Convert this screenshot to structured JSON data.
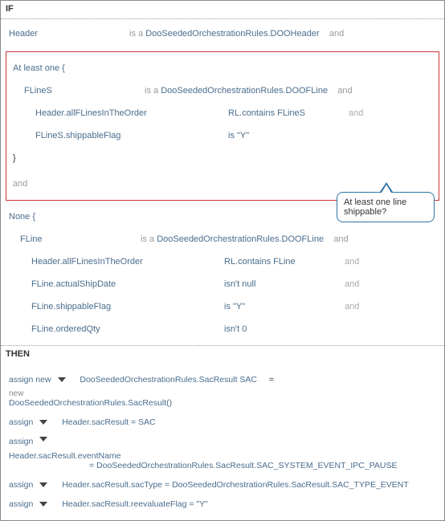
{
  "ifLabel": "IF",
  "thenLabel": "THEN",
  "headerRow": {
    "var": "Header",
    "isA": "is a",
    "type": "DooSeededOrchestrationRules.DOOHeader",
    "and": "and"
  },
  "atLeast": {
    "open": "At least one  {",
    "close": "}",
    "flines": {
      "var": "FLineS",
      "isA": "is a",
      "type": "DooSeededOrchestrationRules.DOOFLine",
      "and": "and"
    },
    "cond1": {
      "lhs": "Header.allFLinesInTheOrder",
      "op": "RL.contains",
      "rhs": "FLineS",
      "and": "and"
    },
    "cond2": {
      "lhs": "FLineS.shippableFlag",
      "op": "is",
      "rhs": "\"Y\""
    },
    "trailAnd": "and"
  },
  "callout": "At least one line shippable?",
  "none": {
    "open": "None  {",
    "fline": {
      "var": "FLine",
      "isA": "is a",
      "type": "DooSeededOrchestrationRules.DOOFLine",
      "and": "and"
    },
    "c1": {
      "lhs": "Header.allFLinesInTheOrder",
      "op": "RL.contains",
      "rhs": "FLine",
      "and": "and"
    },
    "c2": {
      "lhs": "FLine.actualShipDate",
      "op": "isn't",
      "rhs": "null",
      "and": "and"
    },
    "c3": {
      "lhs": "FLine.shippableFlag",
      "op": "is",
      "rhs": "\"Y\"",
      "and": "and"
    },
    "c4": {
      "lhs": "FLine.orderedQty",
      "op": "isn't",
      "rhs": "0"
    }
  },
  "then": {
    "r1": {
      "kw": "assign new",
      "lhs": "DooSeededOrchestrationRules.SacResult  SAC",
      "eq": "=",
      "newLabel": "new",
      "rhs": "DooSeededOrchestrationRules.SacResult()"
    },
    "r2": {
      "kw": "assign",
      "expr": "Header.sacResult  =  SAC"
    },
    "r3": {
      "kw": "assign",
      "lhs": "Header.sacResult.eventName",
      "rhs": "=  DooSeededOrchestrationRules.SacResult.SAC_SYSTEM_EVENT_IPC_PAUSE"
    },
    "r4": {
      "kw": "assign",
      "expr": "Header.sacResult.sacType  =  DooSeededOrchestrationRules.SacResult.SAC_TYPE_EVENT"
    },
    "r5": {
      "kw": "assign",
      "expr": "Header.sacResult.reevaluateFlag  =  \"Y\""
    }
  }
}
